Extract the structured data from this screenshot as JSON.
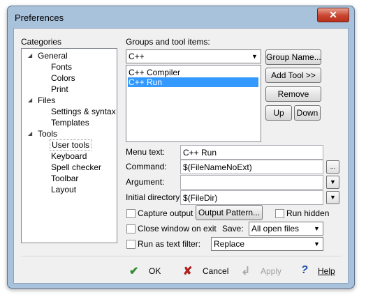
{
  "window": {
    "title": "Preferences",
    "close_glyph": "✕"
  },
  "categories": {
    "label": "Categories",
    "groups": [
      {
        "label": "General",
        "children": [
          "Fonts",
          "Colors",
          "Print"
        ]
      },
      {
        "label": "Files",
        "children": [
          "Settings & syntax",
          "Templates"
        ]
      },
      {
        "label": "Tools",
        "children": [
          "User tools",
          "Keyboard",
          "Spell checker",
          "Toolbar",
          "Layout"
        ]
      }
    ],
    "selected": "User tools"
  },
  "groups_tools": {
    "label": "Groups and tool items:",
    "group_select": "C++",
    "items": [
      "C++ Compiler",
      "C++ Run"
    ],
    "selected_item": "C++ Run"
  },
  "buttons": {
    "group_name": "Group Name...",
    "add_tool": "Add Tool >>",
    "remove": "Remove",
    "up": "Up",
    "down": "Down",
    "output_pattern": "Output Pattern...",
    "browse": "..."
  },
  "fields": {
    "menu_text_label": "Menu text:",
    "menu_text": "C++ Run",
    "command_label": "Command:",
    "command": "$(FileNameNoExt)",
    "argument_label": "Argument:",
    "argument": "",
    "initial_dir_label": "Initial directory:",
    "initial_dir": "$(FileDir)"
  },
  "options": {
    "capture_output": "Capture output",
    "run_hidden": "Run hidden",
    "close_on_exit": "Close window on exit",
    "save_label": "Save:",
    "save_value": "All open files",
    "run_as_filter": "Run as text filter:",
    "filter_value": "Replace"
  },
  "footer": {
    "ok": "OK",
    "cancel": "Cancel",
    "apply": "Apply",
    "help": "Help"
  },
  "colors": {
    "selection": "#3399ff",
    "ok_check": "#2e8b2e",
    "cancel_x": "#b02020",
    "help_q": "#1f4fa8"
  }
}
